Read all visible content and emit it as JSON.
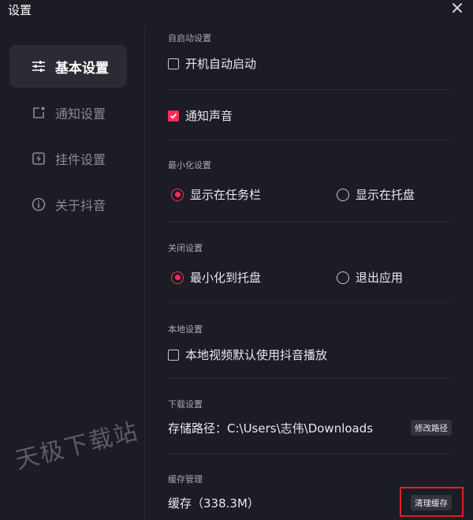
{
  "window": {
    "title": "设置"
  },
  "sidebar": {
    "items": [
      {
        "label": "基本设置",
        "icon": "sliders-icon",
        "active": true
      },
      {
        "label": "通知设置",
        "icon": "notification-icon",
        "active": false
      },
      {
        "label": "挂件设置",
        "icon": "widget-icon",
        "active": false
      },
      {
        "label": "关于抖音",
        "icon": "info-icon",
        "active": false
      }
    ]
  },
  "sections": {
    "autostart": {
      "label": "自启动设置",
      "boot_start": "开机自动启动",
      "notify_sound": "通知声音"
    },
    "minimize": {
      "label": "最小化设置",
      "taskbar": "显示在任务栏",
      "tray": "显示在托盘"
    },
    "close": {
      "label": "关闭设置",
      "to_tray": "最小化到托盘",
      "exit": "退出应用"
    },
    "local": {
      "label": "本地设置",
      "default_player": "本地视频默认使用抖音播放"
    },
    "download": {
      "label": "下载设置",
      "path_text": "存储路径：C:\\Users\\志伟\\Downloads",
      "change_button": "修改路径"
    },
    "cache": {
      "label": "缓存管理",
      "size_text": "缓存（338.3M）",
      "clear_button": "清理缓存"
    }
  },
  "watermark": "天极下载站",
  "colors": {
    "accent": "#fe2c55",
    "background": "#1c1c25",
    "highlight": "#e02020"
  }
}
